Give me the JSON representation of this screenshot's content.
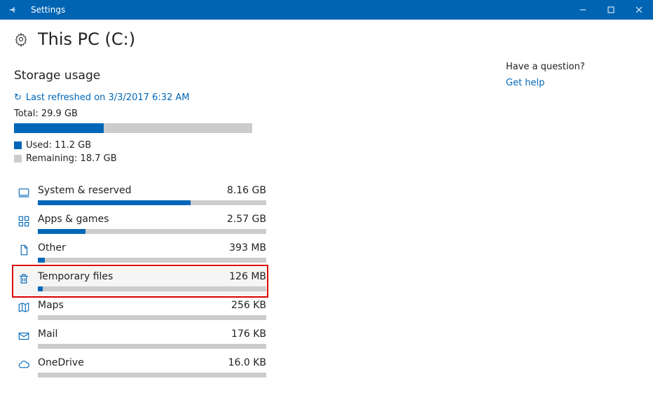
{
  "titlebar": {
    "app_title": "Settings"
  },
  "page": {
    "title": "This PC (C:)"
  },
  "section_heading": "Storage usage",
  "refresh_text": "Last refreshed on 3/3/2017 6:32 AM",
  "totals": {
    "label": "Total: 29.9 GB",
    "used_label": "Used: 11.2 GB",
    "remaining_label": "Remaining: 18.7 GB",
    "used_pct": 37.5
  },
  "categories": [
    {
      "id": "system",
      "icon": "pc-icon",
      "label": "System & reserved",
      "size": "8.16 GB",
      "fill_pct": 67,
      "highlight": false
    },
    {
      "id": "apps",
      "icon": "apps-icon",
      "label": "Apps & games",
      "size": "2.57 GB",
      "fill_pct": 21,
      "highlight": false
    },
    {
      "id": "other",
      "icon": "other-icon",
      "label": "Other",
      "size": "393 MB",
      "fill_pct": 3,
      "highlight": false
    },
    {
      "id": "temp",
      "icon": "trash-icon",
      "label": "Temporary files",
      "size": "126 MB",
      "fill_pct": 2,
      "highlight": true
    },
    {
      "id": "maps",
      "icon": "map-icon",
      "label": "Maps",
      "size": "256 KB",
      "fill_pct": 0,
      "highlight": false
    },
    {
      "id": "mail",
      "icon": "mail-icon",
      "label": "Mail",
      "size": "176 KB",
      "fill_pct": 0,
      "highlight": false
    },
    {
      "id": "onedrive",
      "icon": "cloud-icon",
      "label": "OneDrive",
      "size": "16.0 KB",
      "fill_pct": 0,
      "highlight": false
    }
  ],
  "right_rail": {
    "question": "Have a question?",
    "help_link": "Get help"
  }
}
